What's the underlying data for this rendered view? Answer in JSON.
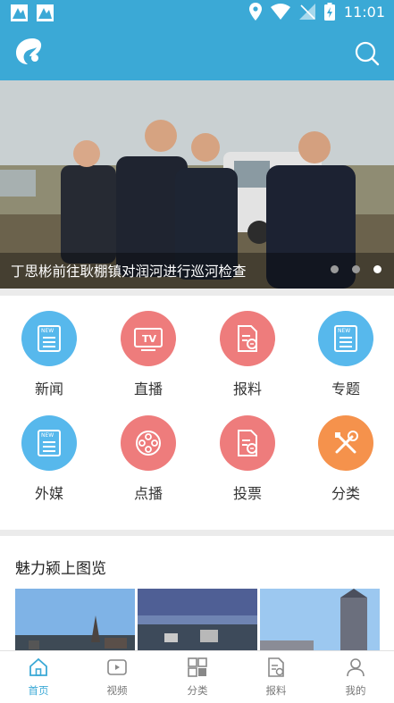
{
  "status_bar": {
    "time": "11:01"
  },
  "banner": {
    "caption": "丁思彬前往耿棚镇对润河进行巡河检查",
    "slide_count": 3,
    "active_slide": 3
  },
  "grid": [
    {
      "label": "新闻",
      "icon": "news-icon",
      "color": "#57b8ec"
    },
    {
      "label": "直播",
      "icon": "tv-icon",
      "color": "#ee7c7c"
    },
    {
      "label": "报料",
      "icon": "report-doc-icon",
      "color": "#ee7c7c"
    },
    {
      "label": "专题",
      "icon": "news-icon",
      "color": "#57b8ec"
    },
    {
      "label": "外媒",
      "icon": "news-icon",
      "color": "#57b8ec"
    },
    {
      "label": "点播",
      "icon": "film-reel-icon",
      "color": "#ee7c7c"
    },
    {
      "label": "投票",
      "icon": "report-doc-icon",
      "color": "#ee7c7c"
    },
    {
      "label": "分类",
      "icon": "tools-icon",
      "color": "#f5924c"
    }
  ],
  "gallery": {
    "title": "魅力颍上图览"
  },
  "bottom_nav": [
    {
      "label": "首页",
      "icon": "home-icon",
      "active": true
    },
    {
      "label": "视频",
      "icon": "video-icon",
      "active": false
    },
    {
      "label": "分类",
      "icon": "category-grid-icon",
      "active": false
    },
    {
      "label": "报料",
      "icon": "report-icon",
      "active": false
    },
    {
      "label": "我的",
      "icon": "profile-icon",
      "active": false
    }
  ],
  "colors": {
    "primary": "#3ba9d6",
    "accent_blue": "#57b8ec",
    "accent_red": "#ee7c7c",
    "accent_orange": "#f5924c"
  }
}
